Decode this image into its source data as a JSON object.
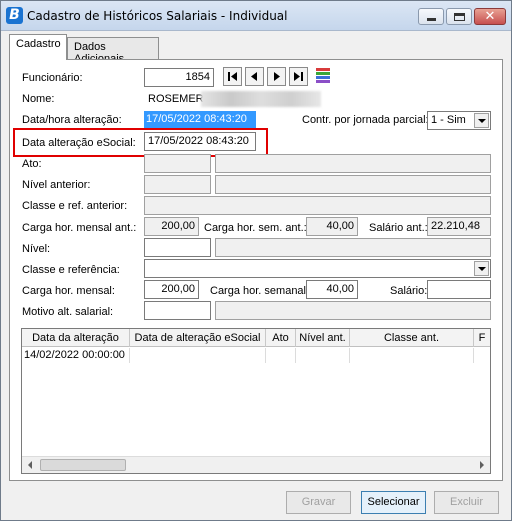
{
  "window": {
    "title": "Cadastro de Históricos Salariais - Individual",
    "close_glyph": "✕"
  },
  "tabs": [
    {
      "label": "Cadastro"
    },
    {
      "label": "Dados Adicionais"
    }
  ],
  "form": {
    "funcionario_label": "Funcionário:",
    "funcionario_value": "1854",
    "nome_label": "Nome:",
    "nome_value": "ROSEMERI",
    "data_hora_label": "Data/hora alteração:",
    "data_hora_value": "17/05/2022 08:43:20",
    "contr_label": "Contr. por jornada parcial:",
    "contr_value": "1 - Sim",
    "data_esocial_label": "Data alteração eSocial:",
    "data_esocial_value": "17/05/2022 08:43:20",
    "ato_label": "Ato:",
    "nivel_anterior_label": "Nível anterior:",
    "classe_ref_anterior_label": "Classe e ref. anterior:",
    "carga_mensal_ant_label": "Carga hor. mensal ant.:",
    "carga_mensal_ant_value": "200,00",
    "carga_sem_ant_label": "Carga hor. sem. ant.:",
    "carga_sem_ant_value": "40,00",
    "salario_ant_label": "Salário ant.:",
    "salario_ant_value": "22.210,48",
    "nivel_label": "Nível:",
    "classe_ref_label": "Classe e referência:",
    "carga_mensal_label": "Carga hor. mensal:",
    "carga_mensal_value": "200,00",
    "carga_semanal_label": "Carga hor. semanal:",
    "carga_semanal_value": "40,00",
    "salario_label": "Salário:",
    "motivo_label": "Motivo alt. salarial:"
  },
  "grid": {
    "columns": [
      "Data da alteração",
      "Data de alteração eSocial",
      "Ato",
      "Nível ant.",
      "Classe ant.",
      "F"
    ],
    "rows": [
      [
        "14/02/2022 00:00:00",
        "",
        "",
        "",
        "",
        ""
      ]
    ]
  },
  "buttons": {
    "gravar": "Gravar",
    "selecionar": "Selecionar",
    "excluir": "Excluir"
  },
  "colors": {
    "highlight": "#e00000",
    "selection": "#3399ff"
  },
  "icons": [
    "first-record-icon",
    "previous-record-icon",
    "next-record-icon",
    "last-record-icon",
    "list-view-icon"
  ]
}
